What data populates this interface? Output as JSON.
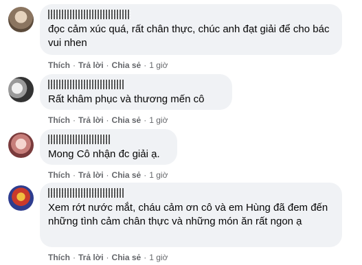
{
  "comments": [
    {
      "text": "đọc cảm xúc quá, rất chân thực, chúc anh đạt giải để cho bác vui nhen",
      "actions": {
        "like": "Thích",
        "reply": "Trả lời",
        "share": "Chia sẻ",
        "time": "1 giờ"
      },
      "avatar_colors": [
        "#c8b39c",
        "#6d5a48"
      ]
    },
    {
      "text": "Rất khâm phục và thương mến cô",
      "actions": {
        "like": "Thích",
        "reply": "Trả lời",
        "share": "Chia sẻ",
        "time": "1 giờ"
      },
      "avatar_colors": [
        "#d8d8d8",
        "#2b2b2b"
      ]
    },
    {
      "text": "Mong Cô nhận đc giải ạ.",
      "actions": {
        "like": "Thích",
        "reply": "Trả lời",
        "share": "Chia sẻ",
        "time": "1 giờ"
      },
      "avatar_colors": [
        "#e8b4b0",
        "#8a3b3a"
      ]
    },
    {
      "text": "Xem rớt nước mắt, cháu cảm ơn cô và em Hùng đã đem đến những tình cảm chân thực và những món ăn rất ngon ạ",
      "actions": {
        "like": "Thích",
        "reply": "Trả lời",
        "share": "Chia sẻ",
        "time": "1 giờ"
      },
      "avatar_colors": [
        "#c93a2b",
        "#2e3d8f"
      ]
    }
  ],
  "colors": {
    "bubble": "#f0f2f5",
    "text": "#050505",
    "secondary": "#65676b"
  }
}
